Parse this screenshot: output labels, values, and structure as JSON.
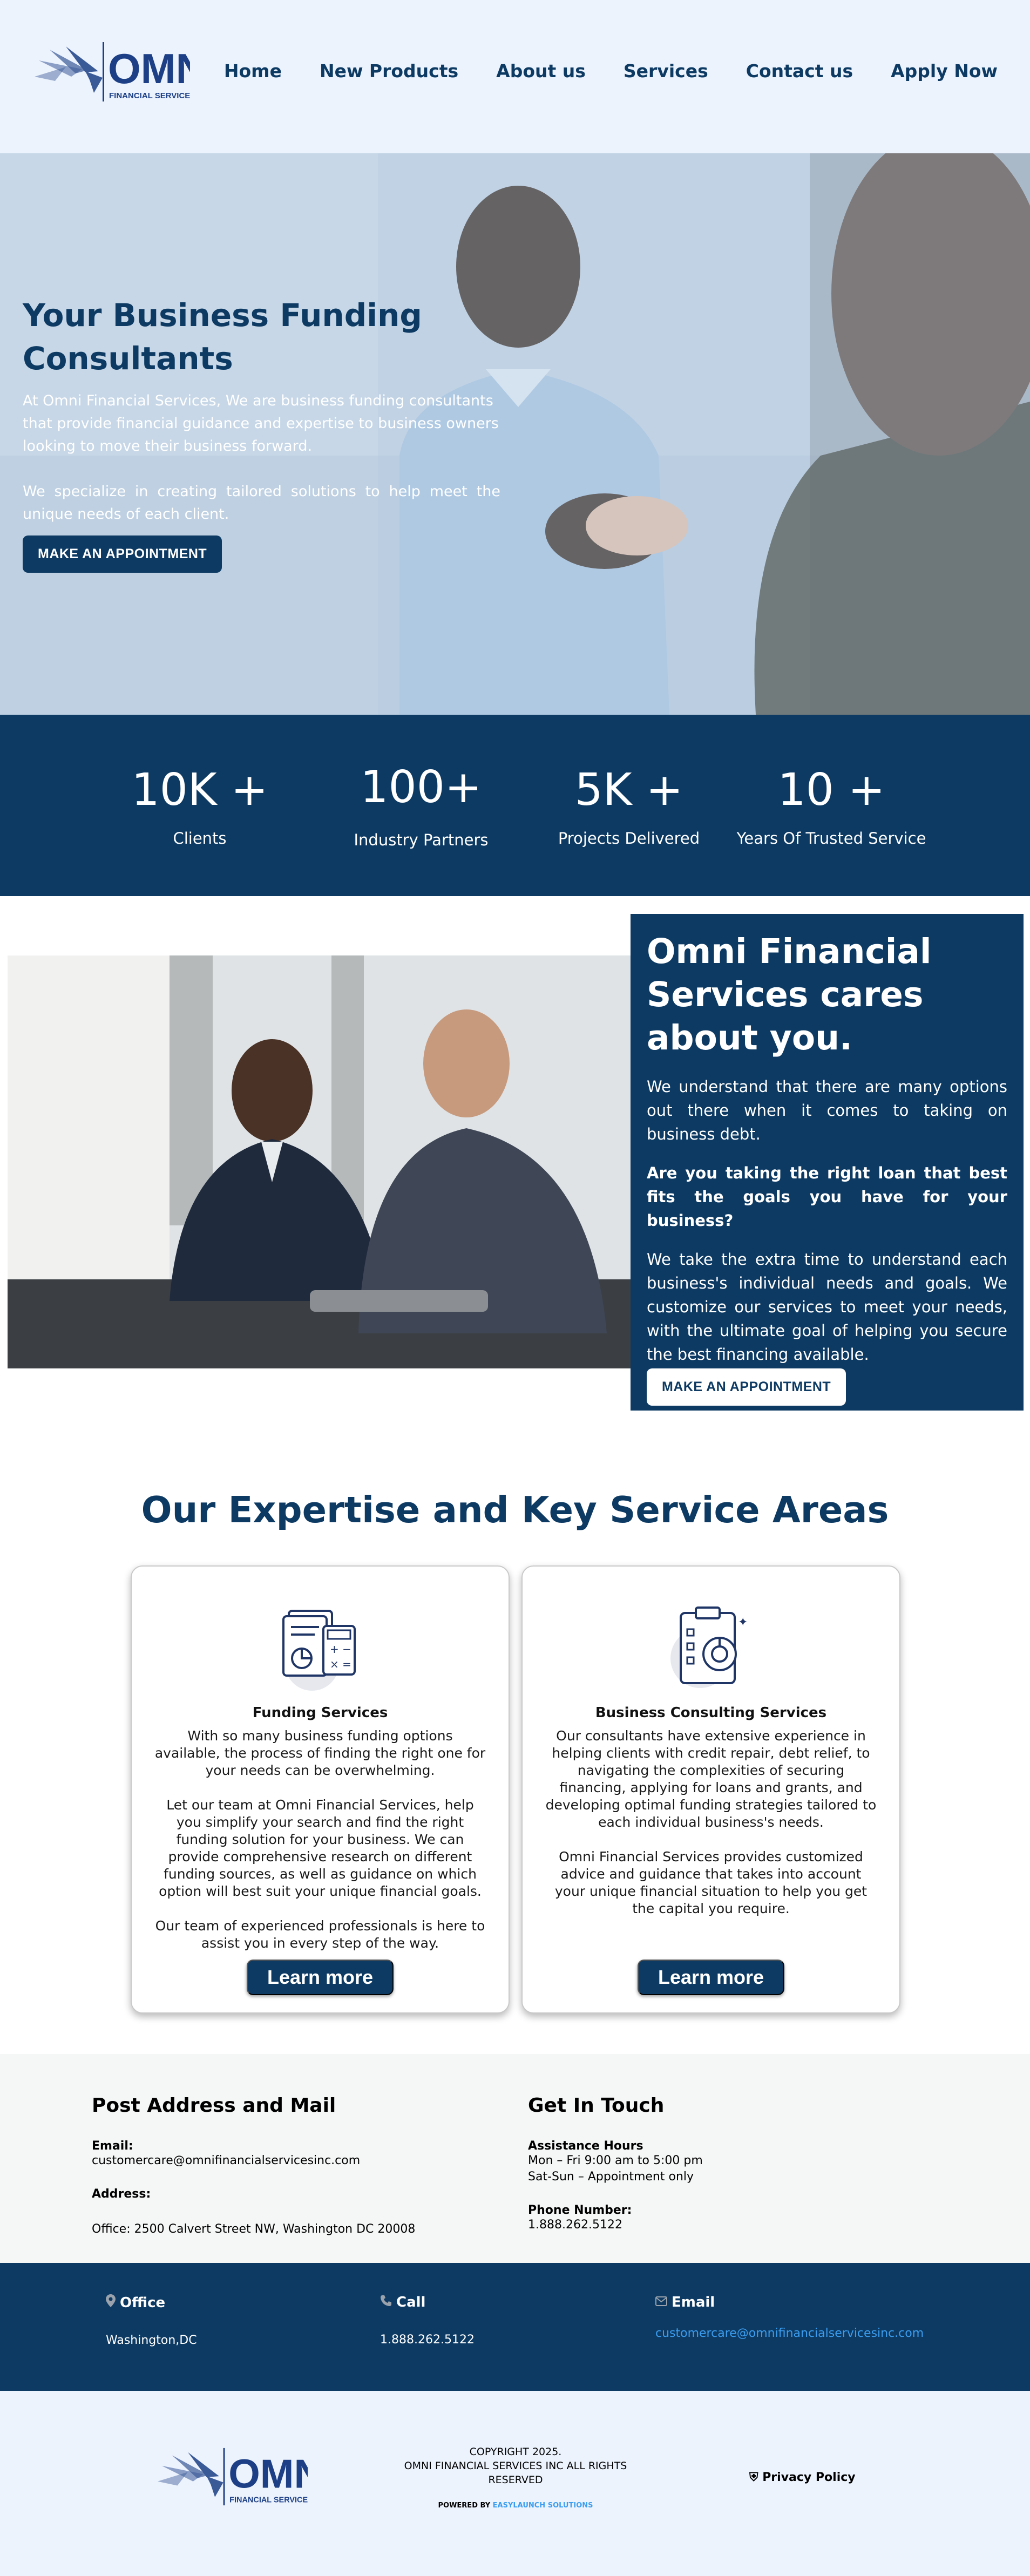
{
  "header": {
    "logo_text": "OMNI",
    "logo_subtext": "FINANCIAL SERVICES",
    "nav": [
      "Home",
      "New Products",
      "About us",
      "Services",
      "Contact us",
      "Apply Now"
    ]
  },
  "hero": {
    "title": "Your Business Funding Consultants",
    "p1": "At Omni Financial Services, We are business funding consultants that provide financial guidance and expertise to business owners looking to move their business forward.",
    "p2": "We specialize in creating tailored solutions to help meet the unique needs of each client.",
    "cta": "MAKE AN APPOINTMENT"
  },
  "stats": [
    {
      "value": "10K +",
      "label": "Clients"
    },
    {
      "value": "100+",
      "label": "Industry Partners"
    },
    {
      "value": "5K +",
      "label": "Projects Delivered"
    },
    {
      "value": "10 +",
      "label": "Years Of Trusted Service"
    }
  ],
  "cares": {
    "title": "Omni Financial Services cares about you.",
    "p1": "We understand that there are many options out there when it comes to taking on business debt.",
    "question": "Are you taking the right loan that best fits the goals you have for your business?",
    "p2": "We take the extra time to understand each business's individual needs and goals. We customize our services to meet your needs, with the ultimate goal of helping you secure the best financing available.",
    "cta": "MAKE AN APPOINTMENT"
  },
  "expertise": {
    "title": "Our Expertise and Key Service Areas",
    "cards": [
      {
        "title": "Funding Services",
        "paragraphs": [
          "With so many business funding options available, the process of finding the right one for your needs can be overwhelming.",
          "Let our team at Omni Financial Services, help you simplify your search and find the right funding solution for your business. We can provide comprehensive research on different funding sources, as well as guidance on which option will best suit your unique financial goals.",
          "Our team of experienced professionals is here to assist you in every step of the way."
        ],
        "button": "Learn more"
      },
      {
        "title": "Business Consulting Services",
        "paragraphs": [
          "Our consultants have extensive experience in helping clients with credit repair, debt relief, to navigating the complexities of securing financing, applying for loans and grants, and developing optimal funding strategies tailored to each individual business's needs.",
          "Omni Financial Services provides customized advice and guidance that takes into account your unique financial situation to help you get the capital you require."
        ],
        "button": "Learn more"
      }
    ]
  },
  "contact": {
    "left_title": "Post Address and Mail",
    "email_label": "Email:",
    "email": "customercare@omnifinancialservicesinc.com",
    "address_label": "Address:",
    "address": "Office: 2500 Calvert Street NW, Washington DC 20008",
    "right_title": "Get In Touch",
    "hours_label": "Assistance Hours",
    "hours_1": "Mon – Fri 9:00 am to 5:00 pm",
    "hours_2": "Sat-Sun – Appointment only",
    "phone_label": "Phone Number:",
    "phone": "1.888.262.5122"
  },
  "strip": {
    "office_label": "Office",
    "office_value": "Washington,DC",
    "call_label": "Call",
    "call_value": "1.888.262.5122",
    "email_label": "Email",
    "email_value": "customercare@omnifinancialservicesinc.com"
  },
  "footer": {
    "copyright": "COPYRIGHT 2025.",
    "company": "OMNI FINANCIAL SERVICES INC ALL RIGHTS RESERVED",
    "powered_prefix": "POWERED BY",
    "powered_link": "EASYLAUNCH SOLUTIONS",
    "privacy": "Privacy Policy"
  },
  "colors": {
    "brand_navy": "#0d3a63",
    "light_bg": "#ecf3fd",
    "link_blue": "#3b9df0"
  }
}
